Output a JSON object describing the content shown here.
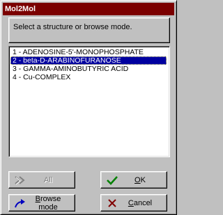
{
  "window": {
    "title": "Mol2Mol"
  },
  "message": {
    "text": "Select a structure or browse mode."
  },
  "structures": {
    "items": [
      {
        "label": "1 - ADENOSINE-5'-MONOPHOSPHATE",
        "selected": false
      },
      {
        "label": "2 - beta-D-ARABINOFURANOSE",
        "selected": true
      },
      {
        "label": "3 - GAMMA-AMINOBUTYRIC ACID",
        "selected": false
      },
      {
        "label": "4 - Cu-COMPLEX",
        "selected": false
      }
    ]
  },
  "buttons": {
    "all": {
      "label": "All",
      "enabled": false,
      "icon": "double-arrow-icon"
    },
    "ok": {
      "prefix": "",
      "underline": "O",
      "suffix": "K",
      "icon": "checkmark-icon"
    },
    "browse": {
      "prefix": "",
      "underline": "B",
      "suffix": "rowse mode",
      "icon": "browse-arrow-icon"
    },
    "cancel": {
      "prefix": "",
      "underline": "C",
      "suffix": "ancel",
      "icon": "cross-icon"
    }
  },
  "colors": {
    "titlebar": "#7b0000",
    "selection": "#0000a0",
    "ok_icon": "#008000",
    "cancel_icon": "#800000",
    "browse_icon": "#0000c0"
  }
}
